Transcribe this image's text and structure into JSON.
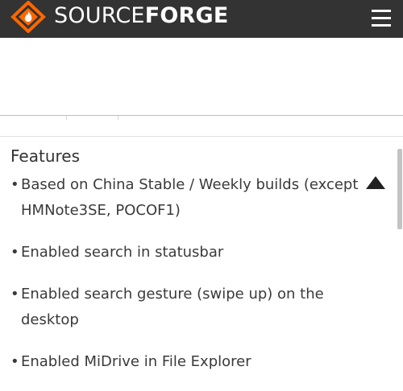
{
  "header": {
    "brand_light": "SOURCE",
    "brand_bold": "FORGE",
    "logo_icon": "sourceforge-diamond-flame-logo",
    "menu_icon": "hamburger-menu-icon",
    "colors": {
      "bar": "#333333",
      "logo_orange": "#ff6600",
      "text": "#ffffff"
    }
  },
  "section": {
    "heading": "Features",
    "items": [
      "Based on China Stable / Weekly builds (except HMNote3SE, POCOF1)",
      "Enabled search in statusbar",
      "Enabled search gesture (swipe up) on the desktop",
      "Enabled MiDrive in File Explorer"
    ]
  },
  "controls": {
    "scroll_top_icon": "triangle-up-icon"
  }
}
